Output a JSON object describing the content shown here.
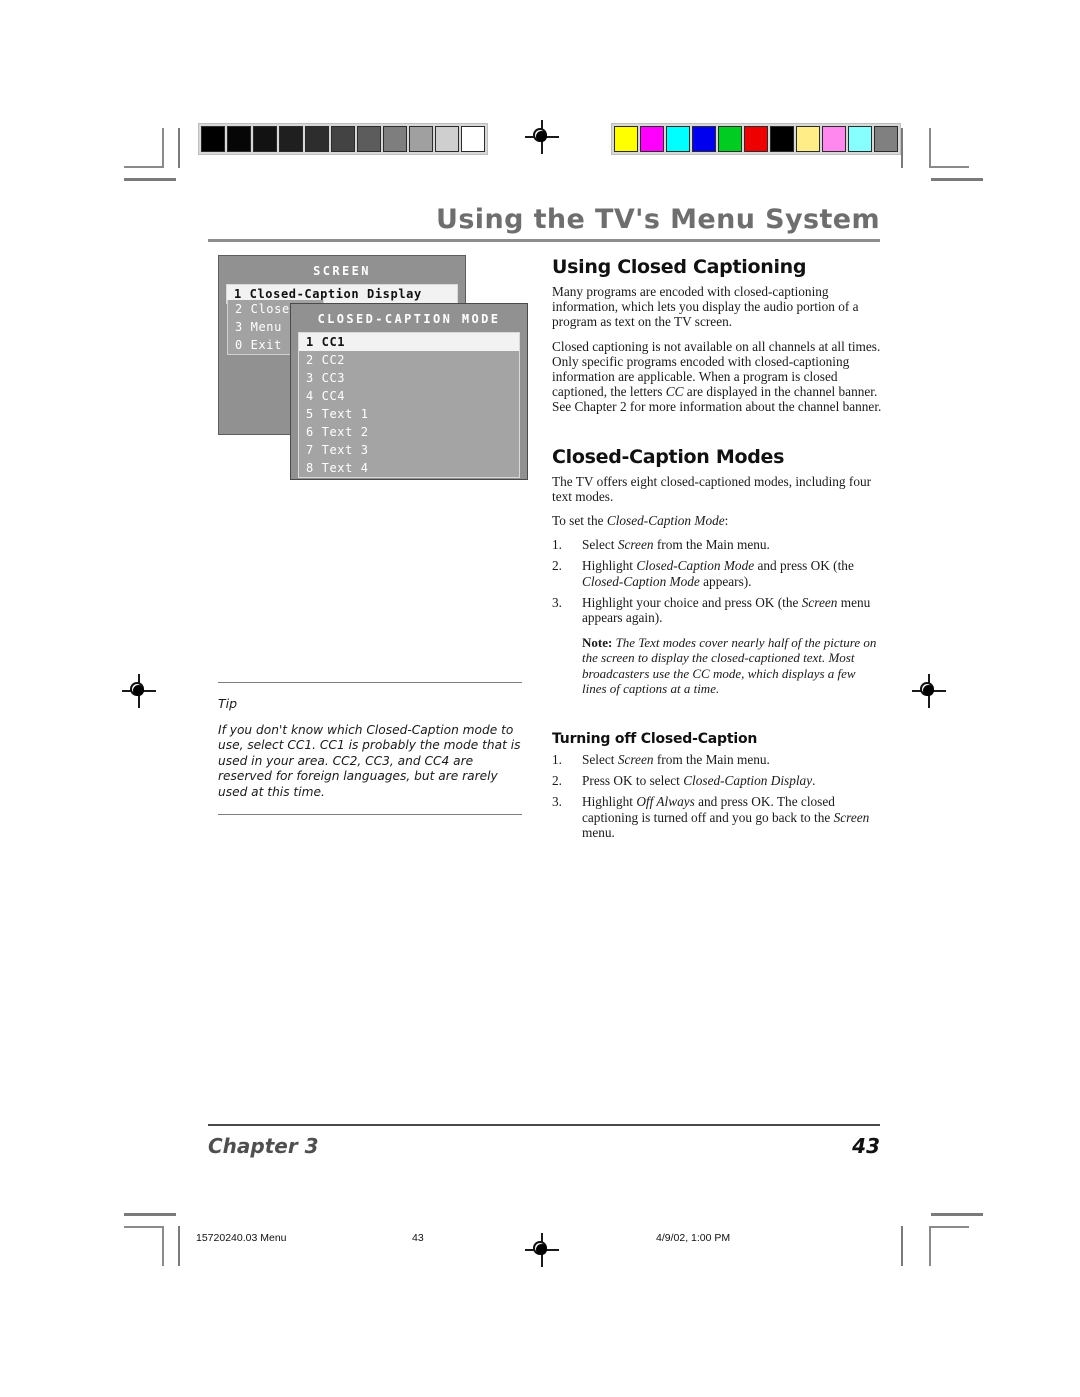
{
  "header": {
    "title": "Using the TV's Menu System"
  },
  "calibration": {
    "gray_bar": {
      "name": "grayscale-calibration-bar",
      "swatches": [
        "#000000",
        "#060606",
        "#121212",
        "#1f1f1f",
        "#2d2d2d",
        "#434343",
        "#5c5c5c",
        "#7e7e7e",
        "#a0a0a0",
        "#cfcfcf",
        "#ffffff"
      ]
    },
    "color_bar": {
      "name": "color-calibration-bar",
      "swatches": [
        "#ffff00",
        "#ff00ff",
        "#00ffff",
        "#0000ee",
        "#00cc22",
        "#ee0000",
        "#000000",
        "#ffee88",
        "#ff88ee",
        "#88ffff",
        "#808080"
      ]
    }
  },
  "tv_menu": {
    "screen_panel": {
      "title": "SCREEN",
      "highlighted_item": "1 Closed-Caption Display",
      "items": [
        "2 Close",
        "3 Menu",
        "0 Exit"
      ]
    },
    "cc_mode_panel": {
      "title": "CLOSED-CAPTION MODE",
      "highlighted_item": "1 CC1",
      "items": [
        "2 CC2",
        "3 CC3",
        "4 CC4",
        "5 Text 1",
        "6 Text 2",
        "7 Text 3",
        "8 Text 4"
      ]
    }
  },
  "main": {
    "section1": {
      "heading": "Using Closed Captioning",
      "p1": "Many programs are encoded with closed-captioning information, which lets you display the audio portion of a program as text on the TV screen.",
      "p2_a": "Closed captioning is not available on all channels at all times. Only specific programs encoded with closed-captioning information are applicable. When a program is closed captioned, the letters ",
      "p2_em": "CC",
      "p2_b": " are displayed in the channel banner. See Chapter 2 for more information about the channel banner."
    },
    "section2": {
      "heading": "Closed-Caption Modes",
      "p1": "The TV offers eight closed-captioned modes, including four text modes.",
      "p2_a": "To set the ",
      "p2_em": "Closed-Caption Mode",
      "p2_b": ":",
      "steps": [
        {
          "num": "1.",
          "a": "Select ",
          "em": "Screen",
          "b": " from the Main menu."
        },
        {
          "num": "2.",
          "a": "Highlight ",
          "em": "Closed-Caption Mode",
          "b": " and press OK  (the ",
          "em2": "Closed-Caption Mode",
          "c": " appears)."
        },
        {
          "num": "3.",
          "a": "Highlight your choice and press OK (the ",
          "em": "Screen",
          "b": " menu appears again)."
        }
      ],
      "note_label": "Note:",
      "note_text": " The Text modes cover nearly half of the picture on the screen to display the closed-captioned text. Most broadcasters use the CC mode, which displays a few lines of captions at a time."
    },
    "section3": {
      "heading": "Turning off Closed-Caption",
      "steps": [
        {
          "num": "1.",
          "a": "Select ",
          "em": "Screen",
          "b": " from the Main menu."
        },
        {
          "num": "2.",
          "a": "Press OK to select ",
          "em": "Closed-Caption Display",
          "b": "."
        },
        {
          "num": "3.",
          "a": "Highlight ",
          "em": "Off Always",
          "b": " and press OK. The closed captioning is turned off and you go back to the ",
          "em2": "Screen",
          "c": " menu."
        }
      ]
    }
  },
  "tip": {
    "label": "Tip",
    "text": "If you don't know which Closed-Caption mode to use, select CC1. CC1 is probably the mode that is used in your area. CC2, CC3, and CC4  are reserved for foreign languages, but are rarely used at this time."
  },
  "footer": {
    "chapter": "Chapter 3",
    "page_number": "43"
  },
  "slug": {
    "file": "15720240.03 Menu",
    "page": "43",
    "date": "4/9/02, 1:00 PM"
  }
}
